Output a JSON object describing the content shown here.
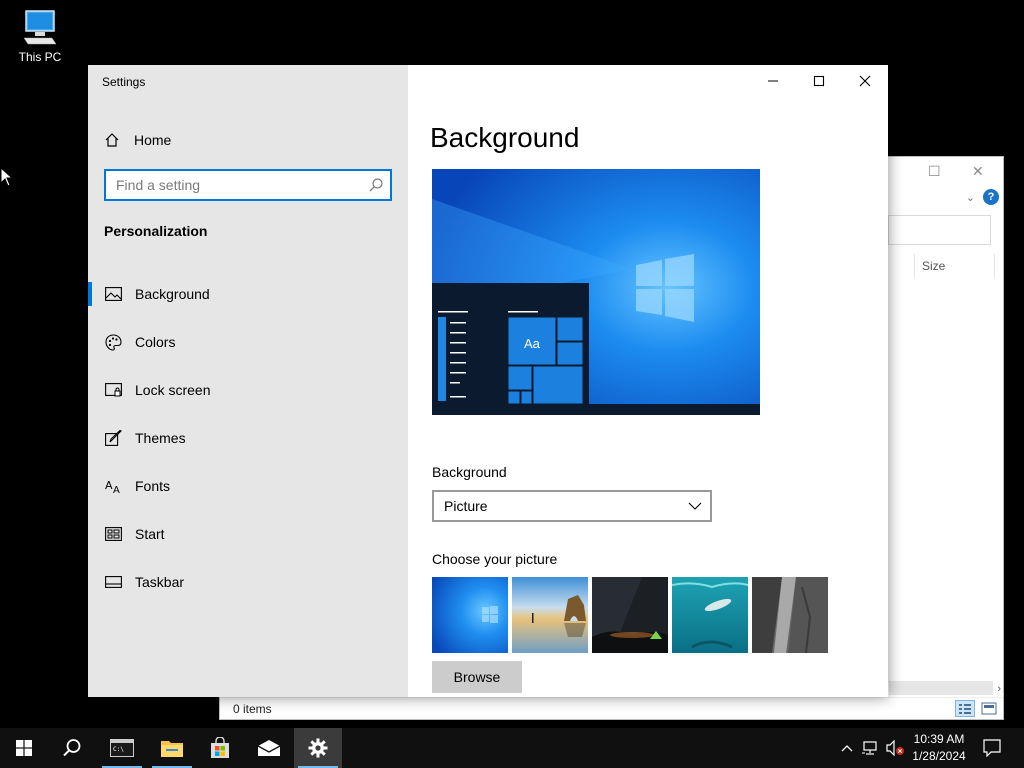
{
  "desktop": {
    "this_pc_label": "This PC"
  },
  "explorer": {
    "column_size": "Size",
    "status_items": "0 items"
  },
  "settings": {
    "window_title": "Settings",
    "home_label": "Home",
    "search_placeholder": "Find a setting",
    "section_heading": "Personalization",
    "nav_items": [
      {
        "label": "Background",
        "icon": "picture-icon",
        "active": true
      },
      {
        "label": "Colors",
        "icon": "palette-icon",
        "active": false
      },
      {
        "label": "Lock screen",
        "icon": "lock-screen-icon",
        "active": false
      },
      {
        "label": "Themes",
        "icon": "brush-icon",
        "active": false
      },
      {
        "label": "Fonts",
        "icon": "font-icon",
        "active": false
      },
      {
        "label": "Start",
        "icon": "start-icon",
        "active": false
      },
      {
        "label": "Taskbar",
        "icon": "taskbar-icon",
        "active": false
      }
    ],
    "page_title": "Background",
    "preview": {
      "tile_text": "Aa"
    },
    "background_label": "Background",
    "background_value": "Picture",
    "choose_picture_label": "Choose your picture",
    "pictures": [
      "windows-blue-wallpaper",
      "beach-rock-arch",
      "night-sky-tent",
      "underwater-swimmer",
      "rock-cliff"
    ],
    "browse_label": "Browse"
  },
  "taskbar": {
    "time": "10:39 AM",
    "date": "1/28/2024",
    "apps": [
      "start-icon",
      "search-icon",
      "terminal-icon",
      "file-explorer-icon",
      "store-icon",
      "mail-icon",
      "settings-gear-icon"
    ]
  },
  "colors": {
    "accent": "#0078d7",
    "sidebar_bg": "#e6e6e6",
    "taskbar_bg": "#101010"
  }
}
